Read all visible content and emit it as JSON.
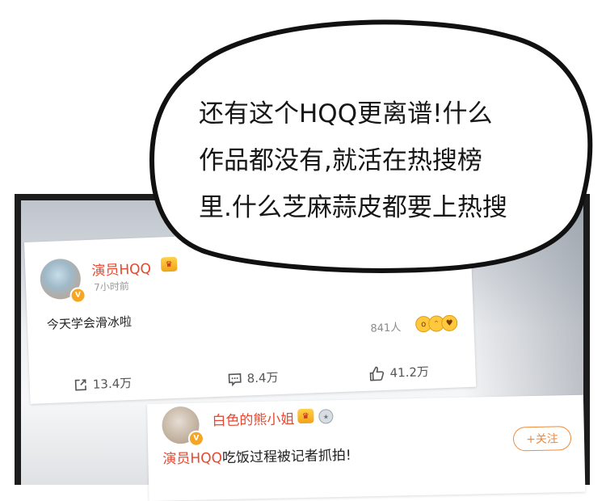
{
  "bubble": {
    "lines": [
      "还有这个HQQ更离谱!什么",
      "作品都没有,就活在热搜榜",
      "里.什么芝麻蒜皮都要上热搜"
    ]
  },
  "post1": {
    "username": "演员HQQ",
    "verified_badge": "V",
    "time": "7小时前",
    "text": "今天学会滑冰啦",
    "read_count": "841人",
    "actions": {
      "share_count": "13.4万",
      "comment_count": "8.4万",
      "like_count": "41.2万"
    }
  },
  "post2": {
    "username": "白色的熊小姐",
    "verified_badge": "V",
    "follow_label": "+关注",
    "mention": "演员HQQ",
    "text": "吃饭过程被记者抓拍!"
  },
  "colors": {
    "username": "#e8472f",
    "follow": "#f08a3a",
    "panel_frame": "#1c1c1c"
  }
}
